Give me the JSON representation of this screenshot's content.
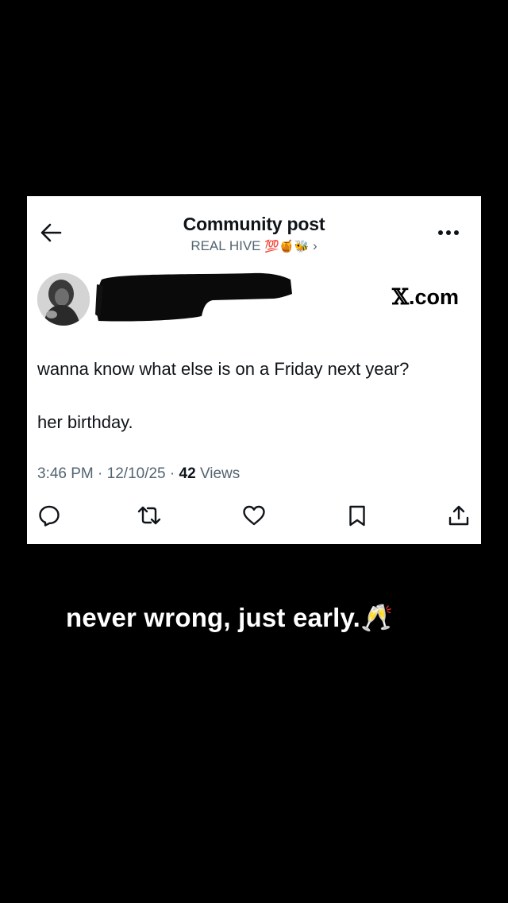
{
  "header": {
    "title": "Community post",
    "community_name": "REAL HIVE",
    "community_emojis": "💯🍯🐝",
    "chevron": "›"
  },
  "post": {
    "watermark": "X.com",
    "watermark_mark": "𝕏",
    "watermark_suffix": ".com",
    "text_line1": "wanna know what else is on a Friday next year?",
    "text_line2": "her birthday.",
    "time": "3:46 PM",
    "date": "12/10/25",
    "separator": "·",
    "views_count": "42",
    "views_label": "Views"
  },
  "actions": [
    "reply-icon",
    "repost-icon",
    "like-icon",
    "bookmark-icon",
    "share-icon"
  ],
  "caption": {
    "text": "never wrong, just early.",
    "emoji": "🥂"
  },
  "colors": {
    "background": "#000000",
    "card": "#ffffff",
    "primary_text": "#0f1419",
    "secondary_text": "#536471"
  }
}
